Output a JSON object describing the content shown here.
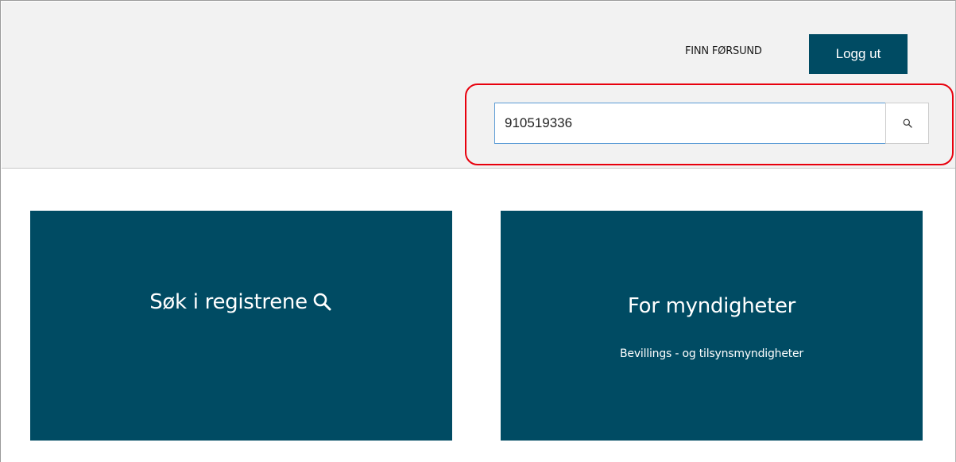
{
  "header": {
    "user_name": "FINN FØRSUND",
    "logout_label": "Logg ut"
  },
  "search": {
    "value": "910519336",
    "button_icon": "search-icon"
  },
  "tiles": [
    {
      "title": "Søk i registrene",
      "icon": "search-icon"
    },
    {
      "title": "For myndigheter",
      "subtitle": "Bevillings - og tilsynsmyndigheter"
    }
  ],
  "colors": {
    "brand": "#004b63",
    "header_bg": "#f2f2f2",
    "highlight": "#e8000d",
    "input_border": "#5b9bd5"
  }
}
